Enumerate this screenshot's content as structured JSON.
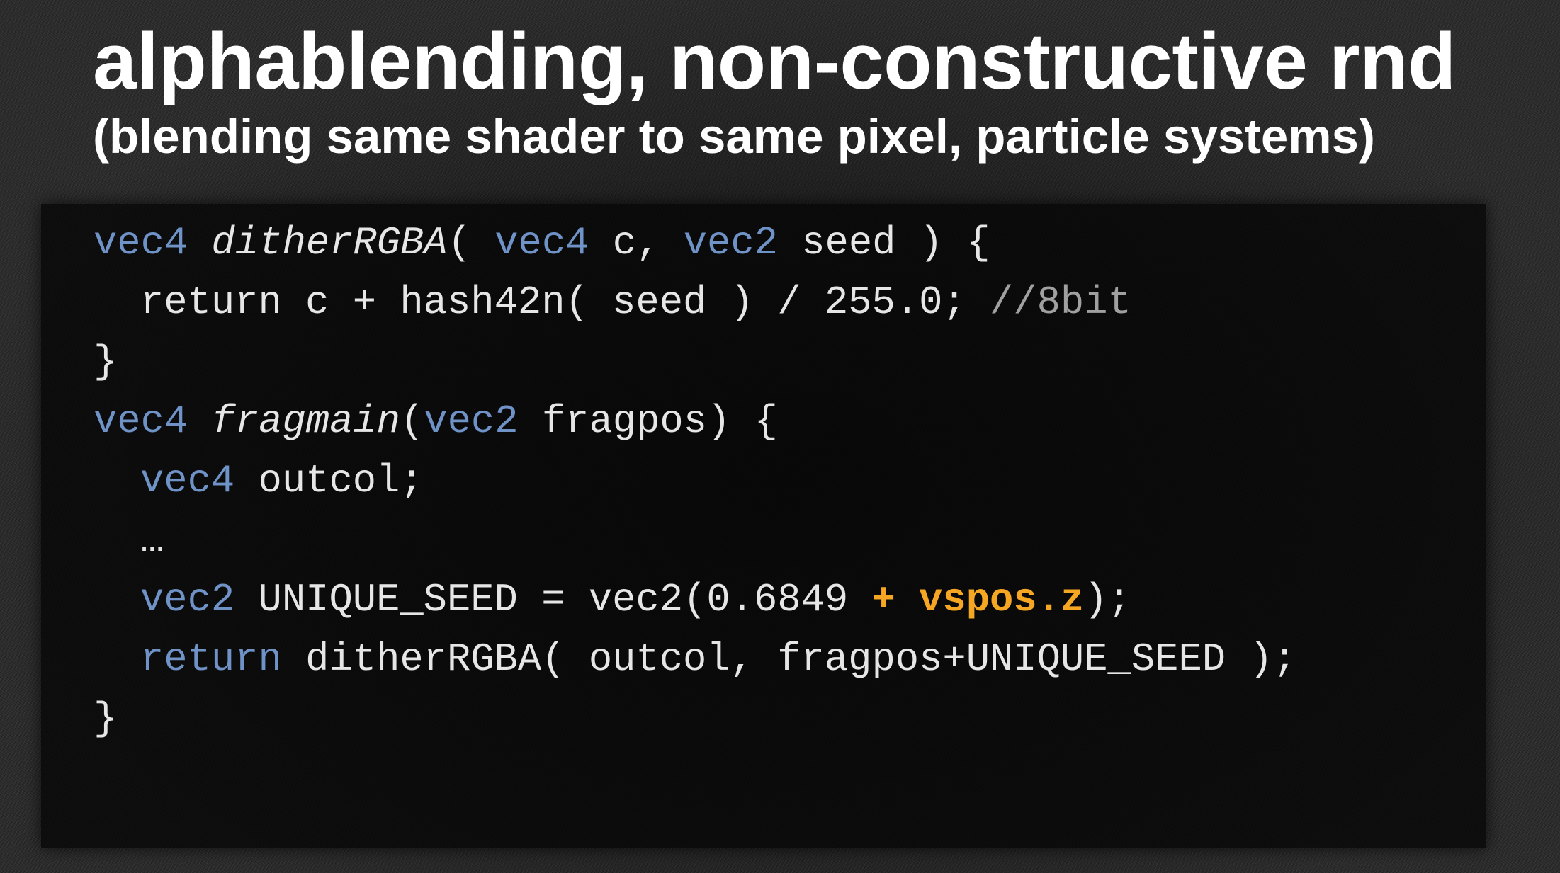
{
  "slide": {
    "title": "alphablending, non-constructive rnd",
    "subtitle": "(blending same shader to same pixel, particle systems)"
  },
  "code": {
    "line1": {
      "t1": "vec4",
      "t2": " ",
      "t3": "ditherRGBA",
      "t4": "( ",
      "t5": "vec4",
      "t6": " c, ",
      "t7": "vec2",
      "t8": " seed ) {"
    },
    "line2": {
      "t1": "return c + hash42n( seed ) / 255.0; ",
      "t2": "//8bit"
    },
    "line3": {
      "t1": "}"
    },
    "line4": {
      "t1": "vec4",
      "t2": " ",
      "t3": "fragmain",
      "t4": "(",
      "t5": "vec2",
      "t6": " fragpos) {"
    },
    "line5": {
      "t1": "vec4",
      "t2": " outcol;"
    },
    "line6": {
      "t1": "…"
    },
    "line7": {
      "t1": "vec2",
      "t2": " UNIQUE_SEED = vec2(0.6849 ",
      "t3": "+ vspos.z",
      "t4": ");"
    },
    "line8": {
      "t1": "return",
      "t2": " ditherRGBA( outcol, fragpos+UNIQUE_SEED );"
    },
    "line9": {
      "t1": "}"
    }
  },
  "colors": {
    "keyword": "#6f92c7",
    "code_text": "#e6e6e6",
    "comment": "#a0a0a0",
    "highlight": "#f5a623",
    "title_text": "#ffffff"
  }
}
